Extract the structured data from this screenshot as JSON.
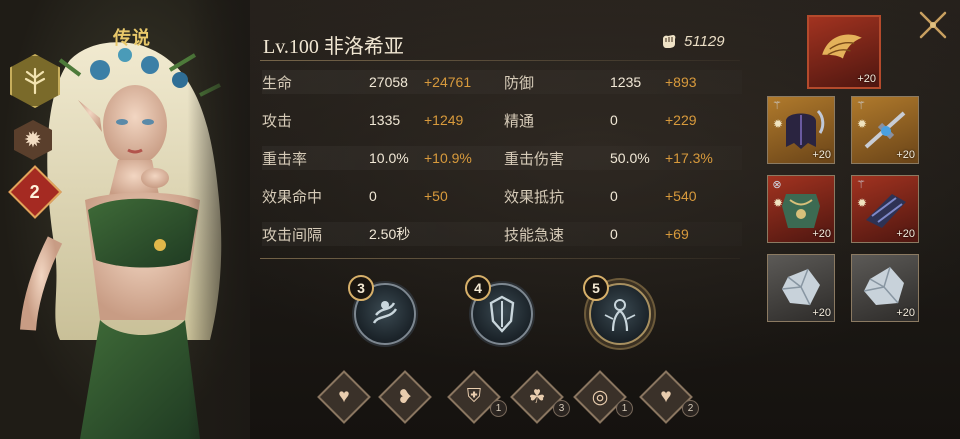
{
  "hero": {
    "rarity": "传说",
    "level_name": "Lv.100 非洛希亚",
    "power": "51129",
    "star_badge": "2"
  },
  "stats": [
    {
      "label": "生命",
      "base": "27058",
      "bonus": "+24761",
      "label2": "防御",
      "base2": "1235",
      "bonus2": "+893"
    },
    {
      "label": "攻击",
      "base": "1335",
      "bonus": "+1249",
      "label2": "精通",
      "base2": "0",
      "bonus2": "+229"
    },
    {
      "label": "重击率",
      "base": "10.0%",
      "bonus": "+10.9%",
      "label2": "重击伤害",
      "base2": "50.0%",
      "bonus2": "+17.3%"
    },
    {
      "label": "效果命中",
      "base": "0",
      "bonus": "+50",
      "label2": "效果抵抗",
      "base2": "0",
      "bonus2": "+540"
    },
    {
      "label": "攻击间隔",
      "base": "2.50秒",
      "bonus": "",
      "label2": "技能急速",
      "base2": "0",
      "bonus2": "+69"
    }
  ],
  "skills": [
    {
      "level": "3",
      "icon": "water-skill-icon"
    },
    {
      "level": "4",
      "icon": "shield-blade-skill-icon"
    },
    {
      "level": "5",
      "icon": "spirit-ultimate-icon"
    }
  ],
  "runes": [
    {
      "icon": "heart-icon",
      "count": ""
    },
    {
      "icon": "heart-heal-icon",
      "count": ""
    },
    {
      "icon": "shield-icon",
      "count": "1"
    },
    {
      "icon": "triple-orb-icon",
      "count": "3"
    },
    {
      "icon": "swirl-icon",
      "count": "1"
    },
    {
      "icon": "heart-plus-icon",
      "count": "2"
    }
  ],
  "equipment": [
    {
      "slot": "artifact",
      "level": "+20",
      "icon": "golden-wing-artifact-icon"
    },
    {
      "slot": "helmet",
      "level": "+20",
      "icon": "dark-helmet-icon"
    },
    {
      "slot": "weapon",
      "level": "+20",
      "icon": "crossbow-icon"
    },
    {
      "slot": "armor",
      "level": "+20",
      "icon": "leaf-armor-icon"
    },
    {
      "slot": "gloves",
      "level": "+20",
      "icon": "gauntlet-icon"
    },
    {
      "slot": "gem-1",
      "level": "+20",
      "icon": "crystal-gem-icon"
    },
    {
      "slot": "gem-2",
      "level": "+20",
      "icon": "crystal-gem-icon"
    }
  ],
  "colors": {
    "bonus": "#d89a3c",
    "accent_gold": "#e8c86a",
    "star_red": "#a52a22"
  }
}
